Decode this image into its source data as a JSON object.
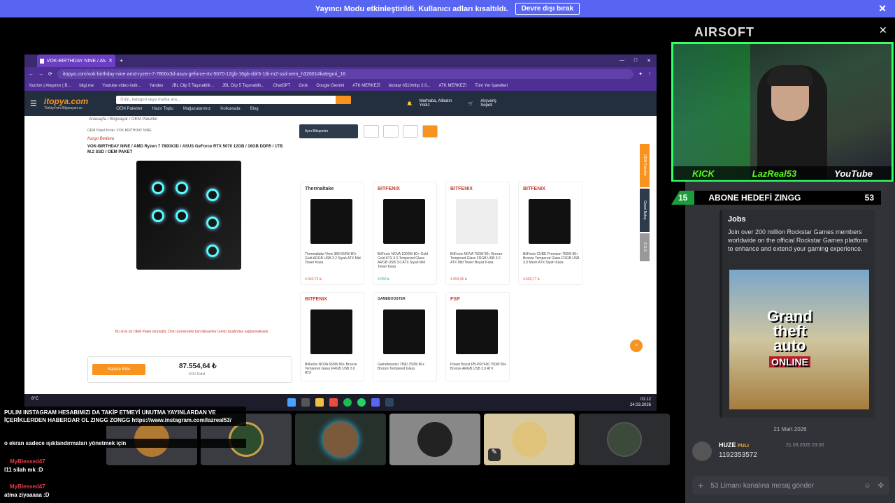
{
  "banner": {
    "text": "Yayıncı Modu etkinleştirildi. Kullanıcı adları kısaltıldı.",
    "button": "Devre dışı bırak"
  },
  "browser": {
    "tab_title": "VOK-BIRTHDAY NINE / AMD R...",
    "url": "itopya.com/vok-birthday-nine-amd-ryzen-7-7800x3d-asus-geforce-rtx-5070-12gb-16gb-ddr5-1tb-m2-ssd-oem_h32661#kategori_16",
    "bookmarks": [
      "Yazılım | Ateşmor | B...",
      "bilgi.me",
      "Youtube video indir...",
      "Yandex",
      "JBL Clip 5 Taşınabilir...",
      "JBL Clip 5 Taşınabilir...",
      "ChatGPT",
      "Grok",
      "Google Gemini",
      "ATK MERKEZİ",
      "biostar h510mhp 2.0...",
      "ATK MERKEZİ",
      "Tüm Yer İşaretleri"
    ]
  },
  "site": {
    "logo": "itopya.com",
    "tagline": "Türkiye'nin Bilgisayarcısı",
    "search_placeholder": "Ürün, kategori veya marka ara...",
    "nav": [
      "OEM Paketler",
      "Hazır Toplu",
      "Mağazalarımız",
      "Kolkanada",
      "Blog"
    ],
    "account": "Merhaba, Alibatın Yıldız",
    "cart": "Alışveriş Sepeti",
    "breadcrumb": "Anasayfa / Bilgisayar / OEM Paketler",
    "oem_code": "OEM Paket Kodu: VOK-BIRTHDAY NINE",
    "cargo": "Kargo Bedava",
    "product_title": "VOK-BIRTHDAY NINE / AMD Ryzen 7 7800X3D / ASUS GeForce RTX 5070 12GB / 16GB DDR5 / 1TB M.2 SSD / OEM PAKET",
    "notice": "Bu ürün bir OEM Paket ürünüdür. Ürün içerisindeki tüm bileşenler üretici tarafından sağlanmaktadır.",
    "price": "87.554,64 ₺",
    "tax": "KDV Dahil",
    "add_to_cart": "Sepete Ekle",
    "tabs_label": "Aynı Bileşenler",
    "side_tabs": [
      "OEM Paketler",
      "Genel Bakış",
      "S.S.S."
    ]
  },
  "products": [
    {
      "brand": "Thermaltake",
      "desc": "Thermaltake View 380 550W 80+ Gold ARGB USB 3.2 Siyah ATX Mid Tower Kasa",
      "price": "4.063,73 ₺"
    },
    {
      "brand": "BITFENIX",
      "desc": "BitFenix NOVA 1000W 80+ Gold Gold ATX 3.0 Tempered Glass ARGB USB 3.0 ATX Siyah Mid Tower Kasa",
      "price": "3.050 ₺"
    },
    {
      "brand": "BITFENIX",
      "desc": "BitFenix NOVA 750W 80+ Bronze Tempered Glass FRGB USB 3.0 ATX Mid Tower Beyaz Kasa",
      "price": "4.659,06 ₺"
    },
    {
      "brand": "BITFENIX",
      "desc": "BitFenix CUBE Premium 750W 80+ Bronze Tempered Glass FRGB USB 3.0 Mesh ATX Siyah Kasa",
      "price": "4.660,77 ₺"
    },
    {
      "brand": "BITFENIX",
      "desc": "BitFenix NOVA 650W 80+ Bronze Tempered Glass FRGB USB 3.0 ATX",
      "price": ""
    },
    {
      "brand": "GAMEBOOSTER",
      "desc": "Gamebooster 7890 750W 80+ Bronze Tempered Glass",
      "price": ""
    },
    {
      "brand": "FSP",
      "desc": "Power Boost PB-PR7400 750W 80+ Bronze ARGB USB 3.0 ATX",
      "price": ""
    }
  ],
  "taskbar": {
    "weather": "8°C",
    "time": "01:12",
    "date": "24.03.2026"
  },
  "stream": {
    "title_logo": "AIRSOFT",
    "socials": [
      "KICK",
      "LazReal53",
      "YouTube"
    ],
    "goal_current": "15",
    "goal_label": "ABONE HEDEFİ ZINGG",
    "goal_target": "53"
  },
  "discord": {
    "embed_title": "Jobs",
    "embed_desc": "Join over 200 million Rockstar Games members worldwide on the official Rockstar Games platform to enhance and extend your gaming experience.",
    "gta_lines": [
      "Grand",
      "theft",
      "auto"
    ],
    "gta_online": "ONLINE",
    "date_separator": "21 Mart 2026",
    "msg_user": "HUZE",
    "msg_tag": "PULI",
    "msg_time": "21.03.2026 23:00",
    "msg_text": "1192353572",
    "input_placeholder": "53 Limanı kanalına mesaj gönder"
  },
  "overlay_chat": [
    {
      "user": "",
      "text": "PULIM INSTAGRAM HESABIMIZI DA TAKİP ETMEYİ UNUTMA YAYINLARDAN VE İÇERİKLERDEN HABERDAR OL ZINGG ZONGG https://www.instagram.com/lazreal53/"
    },
    {
      "user": "",
      "text": "o ekran sadece ışıklandırmaları yönetmek için"
    },
    {
      "user": "MyBlessed47",
      "text": "l11 silah mk :D"
    },
    {
      "user": "MyBlessed47",
      "text": "atma ziyaaaaa :D"
    }
  ]
}
